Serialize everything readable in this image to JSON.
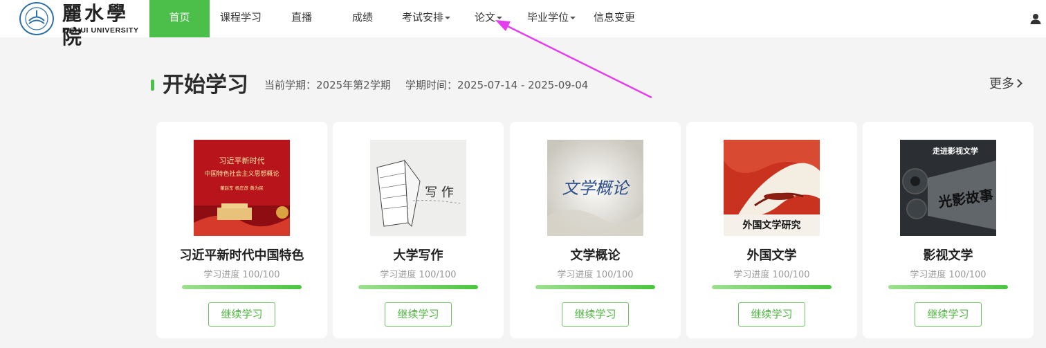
{
  "logo": {
    "cn": "麗水學院",
    "en": "LISHUI UNIVERSITY"
  },
  "nav": {
    "items": [
      {
        "label": "首页",
        "active": true,
        "dropdown": false
      },
      {
        "label": "课程学习",
        "active": false,
        "dropdown": false
      },
      {
        "label": "直播",
        "active": false,
        "dropdown": false
      },
      {
        "label": "成绩",
        "active": false,
        "dropdown": false
      },
      {
        "label": "考试安排",
        "active": false,
        "dropdown": true
      },
      {
        "label": "论文",
        "active": false,
        "dropdown": true
      },
      {
        "label": "毕业学位",
        "active": false,
        "dropdown": true
      },
      {
        "label": "信息变更",
        "active": false,
        "dropdown": false
      }
    ],
    "user_icon": "user-icon"
  },
  "section": {
    "title": "开始学习",
    "term": "当前学期：2025年第2学期",
    "period": "学期时间：2025-07-14 - 2025-09-04",
    "more": "更多"
  },
  "colors": {
    "accent": "#4cbf4b",
    "annotation_arrow": "#e63cf0"
  },
  "courses": [
    {
      "name": "习近平新时代中国特色",
      "progress_text": "学习进度 100/100",
      "progress": 1.0,
      "button": "继续学习",
      "cover_text": "习近平新时代中国特色社会主义思想概论",
      "cover_sub": "董赵东 杨庄彦 黄为民"
    },
    {
      "name": "大学写作",
      "progress_text": "学习进度 100/100",
      "progress": 1.0,
      "button": "继续学习",
      "cover_text": "写 作"
    },
    {
      "name": "文学概论",
      "progress_text": "学习进度 100/100",
      "progress": 1.0,
      "button": "继续学习",
      "cover_text": "文学概论"
    },
    {
      "name": "外国文学",
      "progress_text": "学习进度 100/100",
      "progress": 1.0,
      "button": "继续学习",
      "cover_text": "外国文学研究"
    },
    {
      "name": "影视文学",
      "progress_text": "学习进度 100/100",
      "progress": 1.0,
      "button": "继续学习",
      "cover_text": "走进影视文学",
      "cover_sub": "光影故事"
    }
  ]
}
